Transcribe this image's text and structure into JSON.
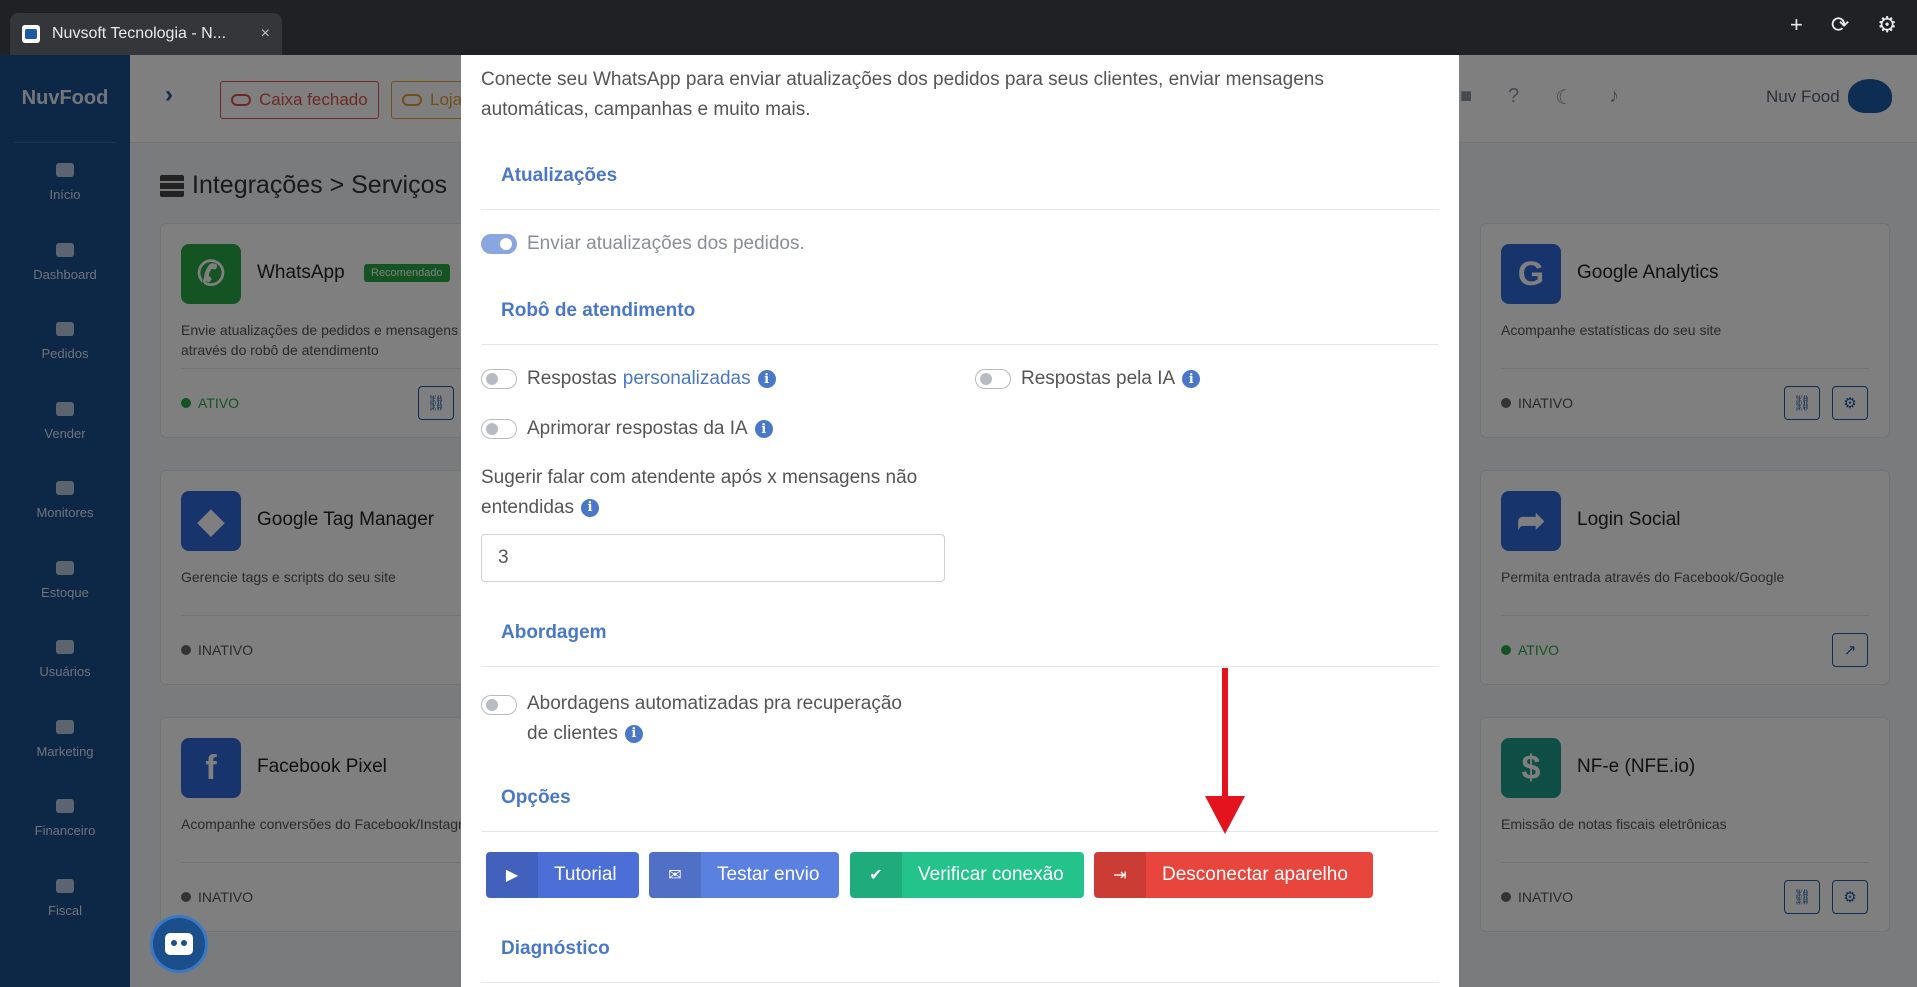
{
  "browser": {
    "tab_title": "Nuvsoft Tecnologia - N...",
    "tab_close": "×",
    "new_tab": "+",
    "reload": "⟳",
    "settings": "⚙"
  },
  "app": {
    "brand": "NuvFood",
    "sidebar": [
      {
        "label": "Início"
      },
      {
        "label": "Dashboard"
      },
      {
        "label": "Pedidos"
      },
      {
        "label": "Vender"
      },
      {
        "label": "Monitores"
      },
      {
        "label": "Estoque"
      },
      {
        "label": "Usuários"
      },
      {
        "label": "Marketing"
      },
      {
        "label": "Financeiro"
      },
      {
        "label": "Fiscal"
      }
    ],
    "topbar": {
      "caixa": "Caixa fechado",
      "loja": "Loja",
      "user": "Nuv Food"
    },
    "page_title": "Integrações > Serviços",
    "cards": [
      {
        "title": "WhatsApp",
        "badge": "Recomendado",
        "desc": "Envie atualizações de pedidos e mensagens automáticas através do robô de atendimento",
        "status": "ATIVO",
        "icon": "whatsapp-icon"
      },
      {
        "title": "Google Analytics",
        "desc": "Acompanhe estatísticas do seu site",
        "status": "INATIVO",
        "icon": "google-icon"
      },
      {
        "title": "Google Tag Manager",
        "desc": "Gerencie tags e scripts do seu site",
        "status": "INATIVO",
        "icon": "tag-icon"
      },
      {
        "title": "Login Social",
        "desc": "Permita entrada através do Facebook/Google",
        "status": "ATIVO",
        "icon": "share-icon"
      },
      {
        "title": "Facebook Pixel",
        "desc": "Acompanhe conversões do Facebook/Instagram",
        "status": "INATIVO",
        "icon": "facebook-icon"
      },
      {
        "title": "NF-e (NFE.io)",
        "desc": "Emissão de notas fiscais eletrônicas",
        "status": "INATIVO",
        "icon": "invoice-icon"
      }
    ]
  },
  "modal": {
    "intro": "Conecte seu WhatsApp para enviar atualizações dos pedidos para seus clientes, enviar mensagens automáticas, campanhas e muito mais.",
    "sections": {
      "atualizacoes": "Atualizações",
      "robo": "Robô de atendimento",
      "abordagem": "Abordagem",
      "opcoes": "Opções",
      "diagnostico": "Diagnóstico"
    },
    "toggles": {
      "enviar_atualizacoes": "Enviar atualizações dos pedidos.",
      "respostas_prefix": "Respostas",
      "respostas_link": "personalizadas",
      "respostas_ia": "Respostas pela IA",
      "aprimorar_ia": "Aprimorar respostas da IA",
      "abordagens_line1": "Abordagens automatizadas pra recuperação",
      "abordagens_line2": "de clientes"
    },
    "sugerir_label_1": "Sugerir falar com atendente após x mensagens não",
    "sugerir_label_2": "entendidas",
    "sugerir_value": "3",
    "info_glyph": "i",
    "buttons": {
      "tutorial": "Tutorial",
      "testar": "Testar envio",
      "verificar": "Verificar conexão",
      "desconectar": "Desconectar aparelho"
    }
  },
  "colors": {
    "accent": "#4a78c9",
    "danger": "#e8453c",
    "success": "#24c38c",
    "arrow": "#e3141d"
  }
}
